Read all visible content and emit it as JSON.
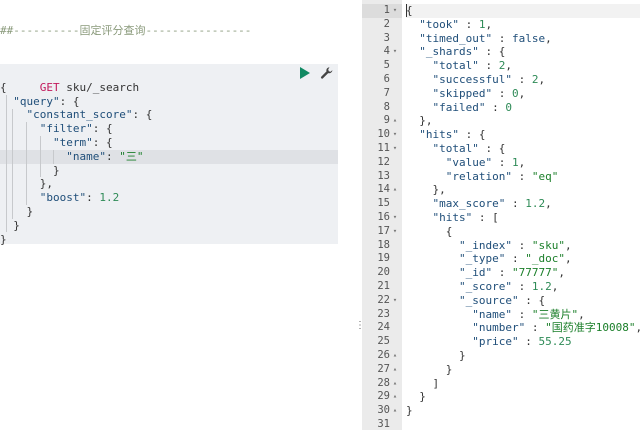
{
  "editor": {
    "comment": "##----------固定评分查询----------------",
    "request": {
      "method": "GET",
      "path": "sku/_search"
    },
    "lines": [
      [
        {
          "t": "{",
          "c": "punc"
        }
      ],
      [
        {
          "t": "  ",
          "c": "punc"
        },
        {
          "t": "\"query\"",
          "c": "key"
        },
        {
          "t": ": {",
          "c": "punc"
        }
      ],
      [
        {
          "t": "    ",
          "c": "punc"
        },
        {
          "t": "\"constant_score\"",
          "c": "key"
        },
        {
          "t": ": {",
          "c": "punc"
        }
      ],
      [
        {
          "t": "      ",
          "c": "punc"
        },
        {
          "t": "\"filter\"",
          "c": "key"
        },
        {
          "t": ": {",
          "c": "punc"
        }
      ],
      [
        {
          "t": "        ",
          "c": "punc"
        },
        {
          "t": "\"term\"",
          "c": "key"
        },
        {
          "t": ": {",
          "c": "punc"
        }
      ],
      [
        {
          "t": "          ",
          "c": "punc"
        },
        {
          "t": "\"name\"",
          "c": "key"
        },
        {
          "t": ": ",
          "c": "punc"
        },
        {
          "t": "\"三\"",
          "c": "str"
        }
      ],
      [
        {
          "t": "        }",
          "c": "punc"
        }
      ],
      [
        {
          "t": "      },",
          "c": "punc"
        }
      ],
      [
        {
          "t": "      ",
          "c": "punc"
        },
        {
          "t": "\"boost\"",
          "c": "key"
        },
        {
          "t": ": ",
          "c": "punc"
        },
        {
          "t": "1.2",
          "c": "num"
        }
      ],
      [
        {
          "t": "    }",
          "c": "punc"
        }
      ],
      [
        {
          "t": "  }",
          "c": "punc"
        }
      ],
      [
        {
          "t": "}",
          "c": "punc"
        }
      ]
    ],
    "active_line": 5,
    "run_icon": "play-icon",
    "settings_icon": "wrench-icon"
  },
  "response": {
    "gutter": [
      {
        "n": "1",
        "f": "▾"
      },
      {
        "n": "2",
        "f": ""
      },
      {
        "n": "3",
        "f": ""
      },
      {
        "n": "4",
        "f": "▾"
      },
      {
        "n": "5",
        "f": ""
      },
      {
        "n": "6",
        "f": ""
      },
      {
        "n": "7",
        "f": ""
      },
      {
        "n": "8",
        "f": ""
      },
      {
        "n": "9",
        "f": "▴"
      },
      {
        "n": "10",
        "f": "▾"
      },
      {
        "n": "11",
        "f": "▾"
      },
      {
        "n": "12",
        "f": ""
      },
      {
        "n": "13",
        "f": ""
      },
      {
        "n": "14",
        "f": "▴"
      },
      {
        "n": "15",
        "f": ""
      },
      {
        "n": "16",
        "f": "▾"
      },
      {
        "n": "17",
        "f": "▾"
      },
      {
        "n": "18",
        "f": ""
      },
      {
        "n": "19",
        "f": ""
      },
      {
        "n": "20",
        "f": ""
      },
      {
        "n": "21",
        "f": ""
      },
      {
        "n": "22",
        "f": "▾"
      },
      {
        "n": "23",
        "f": ""
      },
      {
        "n": "24",
        "f": ""
      },
      {
        "n": "25",
        "f": ""
      },
      {
        "n": "26",
        "f": "▴"
      },
      {
        "n": "27",
        "f": "▴"
      },
      {
        "n": "28",
        "f": "▴"
      },
      {
        "n": "29",
        "f": "▴"
      },
      {
        "n": "30",
        "f": "▴"
      },
      {
        "n": "31",
        "f": ""
      }
    ],
    "lines": [
      [
        {
          "t": "{",
          "c": "punc"
        }
      ],
      [
        {
          "t": "  ",
          "c": "punc"
        },
        {
          "t": "\"took\"",
          "c": "key"
        },
        {
          "t": " : ",
          "c": "punc"
        },
        {
          "t": "1",
          "c": "num"
        },
        {
          "t": ",",
          "c": "punc"
        }
      ],
      [
        {
          "t": "  ",
          "c": "punc"
        },
        {
          "t": "\"timed_out\"",
          "c": "key"
        },
        {
          "t": " : ",
          "c": "punc"
        },
        {
          "t": "false",
          "c": "kw"
        },
        {
          "t": ",",
          "c": "punc"
        }
      ],
      [
        {
          "t": "  ",
          "c": "punc"
        },
        {
          "t": "\"_shards\"",
          "c": "key"
        },
        {
          "t": " : {",
          "c": "punc"
        }
      ],
      [
        {
          "t": "    ",
          "c": "punc"
        },
        {
          "t": "\"total\"",
          "c": "key"
        },
        {
          "t": " : ",
          "c": "punc"
        },
        {
          "t": "2",
          "c": "num"
        },
        {
          "t": ",",
          "c": "punc"
        }
      ],
      [
        {
          "t": "    ",
          "c": "punc"
        },
        {
          "t": "\"successful\"",
          "c": "key"
        },
        {
          "t": " : ",
          "c": "punc"
        },
        {
          "t": "2",
          "c": "num"
        },
        {
          "t": ",",
          "c": "punc"
        }
      ],
      [
        {
          "t": "    ",
          "c": "punc"
        },
        {
          "t": "\"skipped\"",
          "c": "key"
        },
        {
          "t": " : ",
          "c": "punc"
        },
        {
          "t": "0",
          "c": "num"
        },
        {
          "t": ",",
          "c": "punc"
        }
      ],
      [
        {
          "t": "    ",
          "c": "punc"
        },
        {
          "t": "\"failed\"",
          "c": "key"
        },
        {
          "t": " : ",
          "c": "punc"
        },
        {
          "t": "0",
          "c": "num"
        }
      ],
      [
        {
          "t": "  },",
          "c": "punc"
        }
      ],
      [
        {
          "t": "  ",
          "c": "punc"
        },
        {
          "t": "\"hits\"",
          "c": "key"
        },
        {
          "t": " : {",
          "c": "punc"
        }
      ],
      [
        {
          "t": "    ",
          "c": "punc"
        },
        {
          "t": "\"total\"",
          "c": "key"
        },
        {
          "t": " : {",
          "c": "punc"
        }
      ],
      [
        {
          "t": "      ",
          "c": "punc"
        },
        {
          "t": "\"value\"",
          "c": "key"
        },
        {
          "t": " : ",
          "c": "punc"
        },
        {
          "t": "1",
          "c": "num"
        },
        {
          "t": ",",
          "c": "punc"
        }
      ],
      [
        {
          "t": "      ",
          "c": "punc"
        },
        {
          "t": "\"relation\"",
          "c": "key"
        },
        {
          "t": " : ",
          "c": "punc"
        },
        {
          "t": "\"eq\"",
          "c": "str"
        }
      ],
      [
        {
          "t": "    },",
          "c": "punc"
        }
      ],
      [
        {
          "t": "    ",
          "c": "punc"
        },
        {
          "t": "\"max_score\"",
          "c": "key"
        },
        {
          "t": " : ",
          "c": "punc"
        },
        {
          "t": "1.2",
          "c": "num"
        },
        {
          "t": ",",
          "c": "punc"
        }
      ],
      [
        {
          "t": "    ",
          "c": "punc"
        },
        {
          "t": "\"hits\"",
          "c": "key"
        },
        {
          "t": " : [",
          "c": "punc"
        }
      ],
      [
        {
          "t": "      {",
          "c": "punc"
        }
      ],
      [
        {
          "t": "        ",
          "c": "punc"
        },
        {
          "t": "\"_index\"",
          "c": "key"
        },
        {
          "t": " : ",
          "c": "punc"
        },
        {
          "t": "\"sku\"",
          "c": "str"
        },
        {
          "t": ",",
          "c": "punc"
        }
      ],
      [
        {
          "t": "        ",
          "c": "punc"
        },
        {
          "t": "\"_type\"",
          "c": "key"
        },
        {
          "t": " : ",
          "c": "punc"
        },
        {
          "t": "\"_doc\"",
          "c": "str"
        },
        {
          "t": ",",
          "c": "punc"
        }
      ],
      [
        {
          "t": "        ",
          "c": "punc"
        },
        {
          "t": "\"_id\"",
          "c": "key"
        },
        {
          "t": " : ",
          "c": "punc"
        },
        {
          "t": "\"77777\"",
          "c": "str"
        },
        {
          "t": ",",
          "c": "punc"
        }
      ],
      [
        {
          "t": "        ",
          "c": "punc"
        },
        {
          "t": "\"_score\"",
          "c": "key"
        },
        {
          "t": " : ",
          "c": "punc"
        },
        {
          "t": "1.2",
          "c": "num"
        },
        {
          "t": ",",
          "c": "punc"
        }
      ],
      [
        {
          "t": "        ",
          "c": "punc"
        },
        {
          "t": "\"_source\"",
          "c": "key"
        },
        {
          "t": " : {",
          "c": "punc"
        }
      ],
      [
        {
          "t": "          ",
          "c": "punc"
        },
        {
          "t": "\"name\"",
          "c": "key"
        },
        {
          "t": " : ",
          "c": "punc"
        },
        {
          "t": "\"三黄片\"",
          "c": "str"
        },
        {
          "t": ",",
          "c": "punc"
        }
      ],
      [
        {
          "t": "          ",
          "c": "punc"
        },
        {
          "t": "\"number\"",
          "c": "key"
        },
        {
          "t": " : ",
          "c": "punc"
        },
        {
          "t": "\"国药准字10008\"",
          "c": "str"
        },
        {
          "t": ",",
          "c": "punc"
        }
      ],
      [
        {
          "t": "          ",
          "c": "punc"
        },
        {
          "t": "\"price\"",
          "c": "key"
        },
        {
          "t": " : ",
          "c": "punc"
        },
        {
          "t": "55.25",
          "c": "num"
        }
      ],
      [
        {
          "t": "        }",
          "c": "punc"
        }
      ],
      [
        {
          "t": "      }",
          "c": "punc"
        }
      ],
      [
        {
          "t": "    ]",
          "c": "punc"
        }
      ],
      [
        {
          "t": "  }",
          "c": "punc"
        }
      ],
      [
        {
          "t": "}",
          "c": "punc"
        }
      ],
      [
        {
          "t": "",
          "c": "punc"
        }
      ]
    ],
    "active_line": 0
  },
  "divider": {
    "handle_glyph": "⋮"
  },
  "colors": {
    "method": "#c2185b",
    "key": "#1f4e79",
    "string": "#1b7f2a",
    "number": "#2e8b57",
    "run": "#118a63",
    "gutter_bg": "#ebebeb",
    "request_bg": "#eef0f3"
  }
}
